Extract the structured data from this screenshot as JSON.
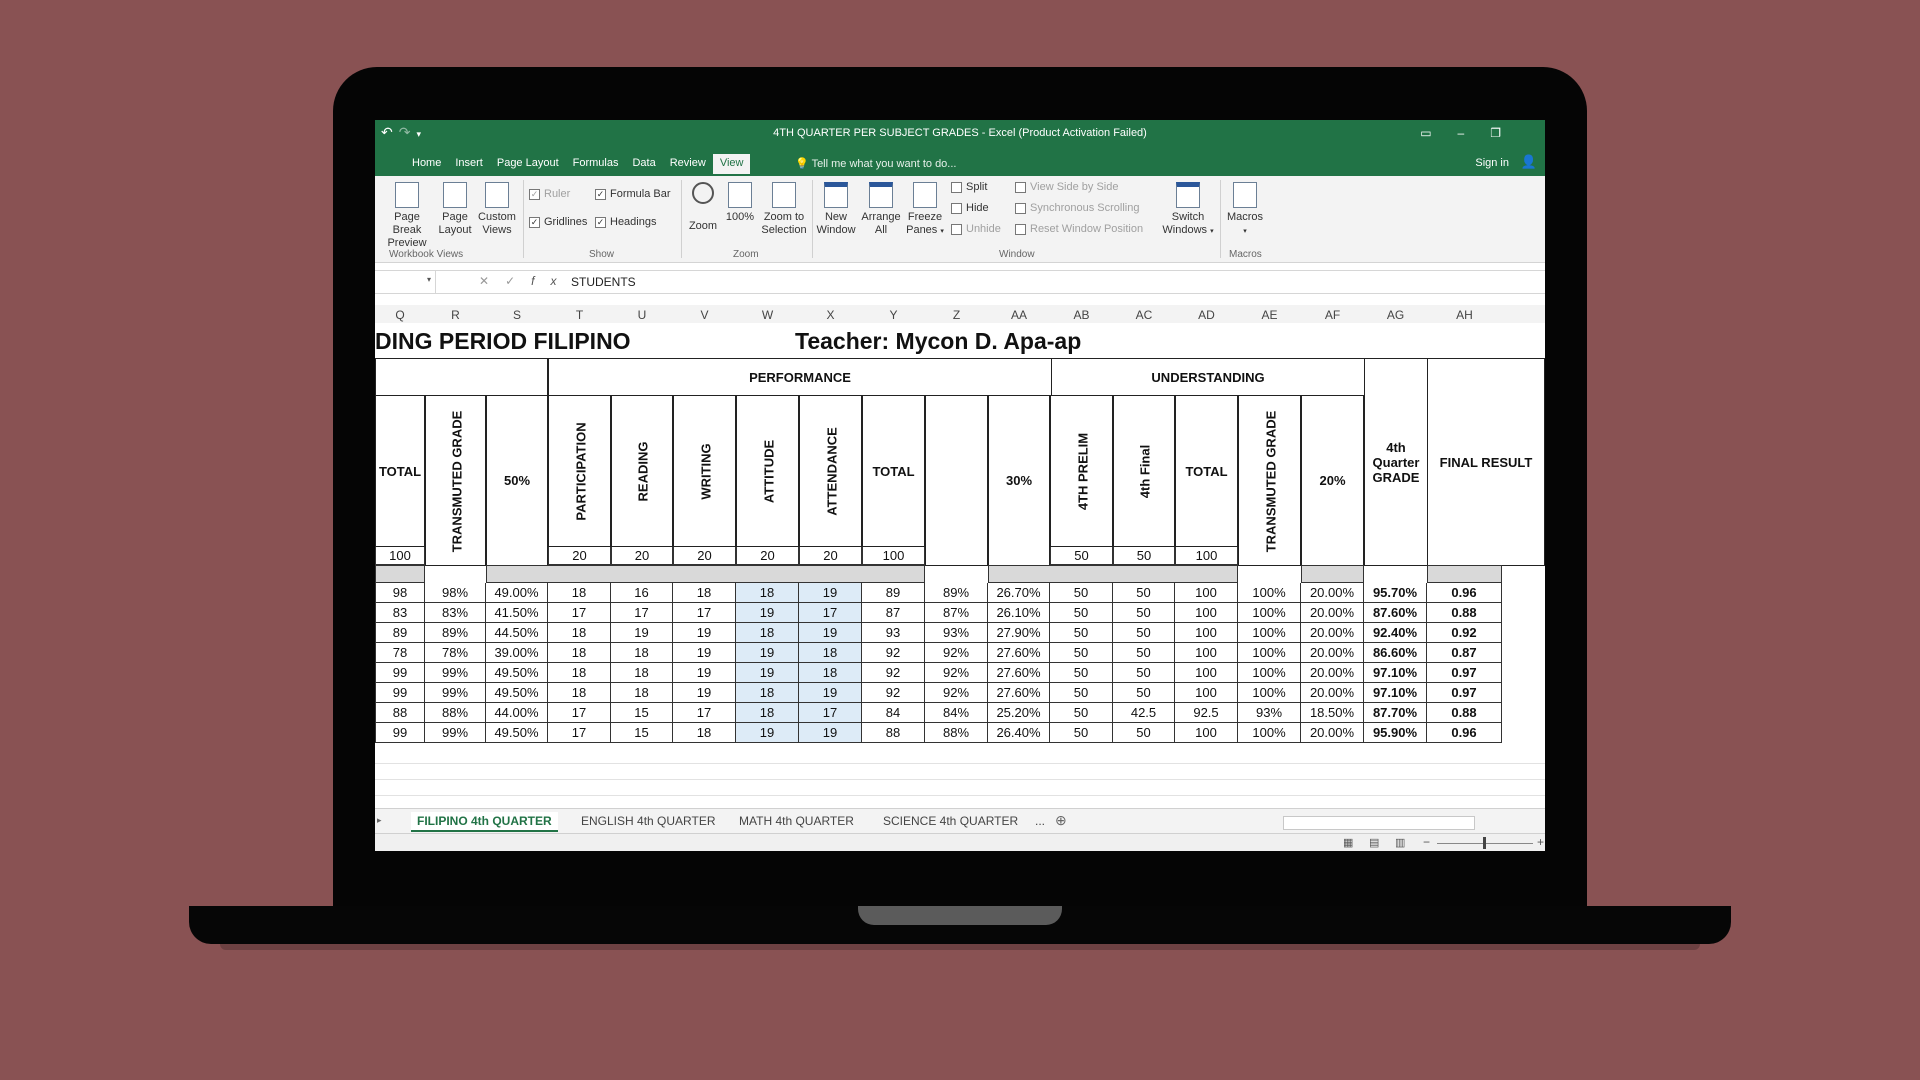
{
  "window": {
    "title": "4TH QUARTER PER SUBJECT GRADES - Excel (Product Activation Failed)",
    "qat_icons": [
      "undo-icon",
      "redo-icon",
      "customize-qat-icon"
    ]
  },
  "menu": {
    "items": [
      "Home",
      "Insert",
      "Page Layout",
      "Formulas",
      "Data",
      "Review",
      "View"
    ],
    "active": "View",
    "tell_me": "Tell me what you want to do...",
    "sign_in": "Sign in"
  },
  "ribbon": {
    "workbook_views": {
      "page_break_1": "Page Break",
      "page_break_2": "Preview",
      "page_layout_1": "Page",
      "page_layout_2": "Layout",
      "custom_1": "Custom",
      "custom_2": "Views",
      "group": "Workbook Views"
    },
    "show": {
      "ruler": "Ruler",
      "formula_bar": "Formula Bar",
      "gridlines": "Gridlines",
      "headings": "Headings",
      "group": "Show"
    },
    "zoom": {
      "zoom": "Zoom",
      "hundred": "100%",
      "zoom_sel_1": "Zoom to",
      "zoom_sel_2": "Selection",
      "group": "Zoom"
    },
    "window": {
      "new_1": "New",
      "new_2": "Window",
      "arrange_1": "Arrange",
      "arrange_2": "All",
      "freeze_1": "Freeze",
      "freeze_2": "Panes",
      "split": "Split",
      "hide": "Hide",
      "unhide": "Unhide",
      "side_by_side": "View Side by Side",
      "sync_scroll": "Synchronous Scrolling",
      "reset_pos": "Reset Window Position",
      "switch_1": "Switch",
      "switch_2": "Windows",
      "group": "Window"
    },
    "macros": {
      "label": "Macros",
      "group": "Macros"
    }
  },
  "formula_bar": {
    "content": "STUDENTS"
  },
  "columns": [
    "Q",
    "R",
    "S",
    "T",
    "U",
    "V",
    "W",
    "X",
    "Y",
    "Z",
    "AA",
    "AB",
    "AC",
    "AD",
    "AE",
    "AF",
    "AG",
    "AH"
  ],
  "sheet": {
    "title_left": "DING PERIOD FILIPINO",
    "title_right": "Teacher: Mycon D. Apa-ap",
    "performance": "PERFORMANCE",
    "understanding": "UNDERSTANDING",
    "headers": {
      "total_cut": "TOTAL",
      "transmuted": "TRANSMUTED GRADE",
      "fifty": "50%",
      "participation": "PARTICIPATION",
      "reading": "READING",
      "writing": "WRITING",
      "attitude": "ATTITUDE",
      "attendance": "ATTENDANCE",
      "total": "TOTAL",
      "thirty": "30%",
      "prelim": "4TH PRELIM",
      "final": "4th Final",
      "total2": "TOTAL",
      "transmuted2": "TRANSMUTED GRADE",
      "twenty": "20%",
      "quarter_grade": "4th Quarter GRADE",
      "final_result": "FINAL RESULT"
    },
    "max_scores": [
      "100",
      "20",
      "20",
      "20",
      "20",
      "20",
      "100",
      "50",
      "50",
      "100"
    ],
    "rows": [
      [
        "98",
        "98%",
        "49.00%",
        "18",
        "16",
        "18",
        "18",
        "19",
        "89",
        "89%",
        "26.70%",
        "50",
        "50",
        "100",
        "100%",
        "20.00%",
        "95.70%",
        "0.96"
      ],
      [
        "83",
        "83%",
        "41.50%",
        "17",
        "17",
        "17",
        "19",
        "17",
        "87",
        "87%",
        "26.10%",
        "50",
        "50",
        "100",
        "100%",
        "20.00%",
        "87.60%",
        "0.88"
      ],
      [
        "89",
        "89%",
        "44.50%",
        "18",
        "19",
        "19",
        "18",
        "19",
        "93",
        "93%",
        "27.90%",
        "50",
        "50",
        "100",
        "100%",
        "20.00%",
        "92.40%",
        "0.92"
      ],
      [
        "78",
        "78%",
        "39.00%",
        "18",
        "18",
        "19",
        "19",
        "18",
        "92",
        "92%",
        "27.60%",
        "50",
        "50",
        "100",
        "100%",
        "20.00%",
        "86.60%",
        "0.87"
      ],
      [
        "99",
        "99%",
        "49.50%",
        "18",
        "18",
        "19",
        "19",
        "18",
        "92",
        "92%",
        "27.60%",
        "50",
        "50",
        "100",
        "100%",
        "20.00%",
        "97.10%",
        "0.97"
      ],
      [
        "99",
        "99%",
        "49.50%",
        "18",
        "18",
        "19",
        "18",
        "19",
        "92",
        "92%",
        "27.60%",
        "50",
        "50",
        "100",
        "100%",
        "20.00%",
        "97.10%",
        "0.97"
      ],
      [
        "88",
        "88%",
        "44.00%",
        "17",
        "15",
        "17",
        "18",
        "17",
        "84",
        "84%",
        "25.20%",
        "50",
        "42.5",
        "92.5",
        "93%",
        "18.50%",
        "87.70%",
        "0.88"
      ],
      [
        "99",
        "99%",
        "49.50%",
        "17",
        "15",
        "18",
        "19",
        "19",
        "88",
        "88%",
        "26.40%",
        "50",
        "50",
        "100",
        "100%",
        "20.00%",
        "95.90%",
        "0.96"
      ]
    ]
  },
  "tabs": [
    "FILIPINO 4th QUARTER",
    "ENGLISH 4th QUARTER",
    "MATH 4th QUARTER",
    "SCIENCE 4th QUARTER",
    "..."
  ],
  "active_tab": "FILIPINO 4th QUARTER"
}
